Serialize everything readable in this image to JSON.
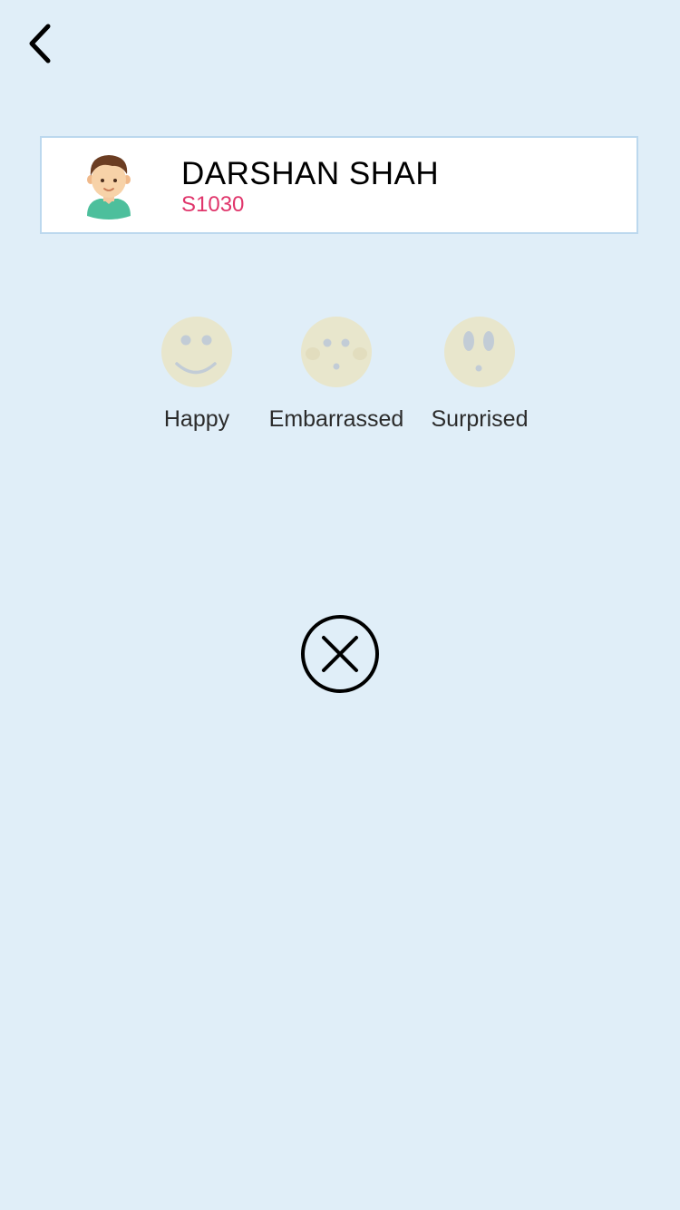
{
  "nav": {
    "back_icon": "chevron-left-icon"
  },
  "student": {
    "name": "DARSHAN SHAH",
    "id": "S1030",
    "avatar_icon": "boy-avatar-icon"
  },
  "emotions": [
    {
      "label": "Happy",
      "icon": "happy-face-icon"
    },
    {
      "label": "Embarrassed",
      "icon": "embarrassed-face-icon"
    },
    {
      "label": "Surprised",
      "icon": "surprised-face-icon"
    }
  ],
  "actions": {
    "close_icon": "close-circle-icon"
  },
  "colors": {
    "background": "#e0eef8",
    "card_border": "#bcd8ee",
    "student_id": "#e0356b",
    "face_fill": "#e8e6cc",
    "face_features": "#c2ccd6"
  }
}
